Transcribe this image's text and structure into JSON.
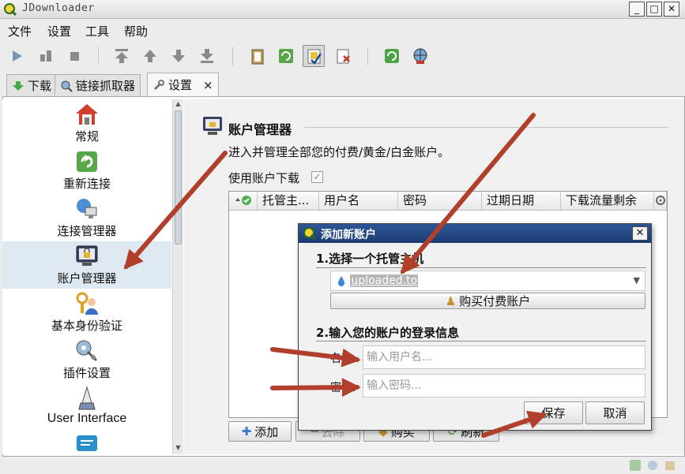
{
  "window": {
    "title": "JDownloader",
    "btn_min": "_",
    "btn_max": "□",
    "btn_close": "✕"
  },
  "menu": [
    "文件",
    "设置",
    "工具",
    "帮助"
  ],
  "tabs": [
    {
      "label": "下载"
    },
    {
      "label": "链接抓取器"
    },
    {
      "label": "设置",
      "close": "×"
    }
  ],
  "sidebar": {
    "items": [
      {
        "label": "常规",
        "icon": "house-icon"
      },
      {
        "label": "重新连接",
        "icon": "reconnect-icon"
      },
      {
        "label": "连接管理器",
        "icon": "network-icon"
      },
      {
        "label": "账户管理器",
        "icon": "lock-monitor-icon",
        "selected": true
      },
      {
        "label": "基本身份验证",
        "icon": "user-key-icon"
      },
      {
        "label": "插件设置",
        "icon": "plugin-gear-icon"
      },
      {
        "label": "User Interface",
        "icon": "brush-icon"
      }
    ]
  },
  "account_manager": {
    "title": "账户管理器",
    "description": "进入并管理全部您的付费/黄金/白金账户。",
    "use_accounts_label": "使用账户下载",
    "columns": [
      "托管主...",
      "用户名",
      "密码",
      "过期日期",
      "下载流量剩余"
    ],
    "buttons": {
      "add": "添加",
      "remove": "去除",
      "buy": "购买",
      "refresh": "刷新"
    }
  },
  "dialog": {
    "title": "添加新账户",
    "close": "✕",
    "step1": "1.选择一个托管主机",
    "host_value": "uploaded.to",
    "buy_premium": "购买付费账户",
    "step2": "2.输入您的账户的登录信息",
    "username_label": "名称:",
    "username_placeholder": "输入用户名...",
    "password_label": "密码:",
    "password_placeholder": "输入密码...",
    "save": "保存",
    "cancel": "取消"
  },
  "colors": {
    "arrow": "#b0402c",
    "dialog_title": "#1f4580",
    "selected_row": "#dde8f0"
  }
}
